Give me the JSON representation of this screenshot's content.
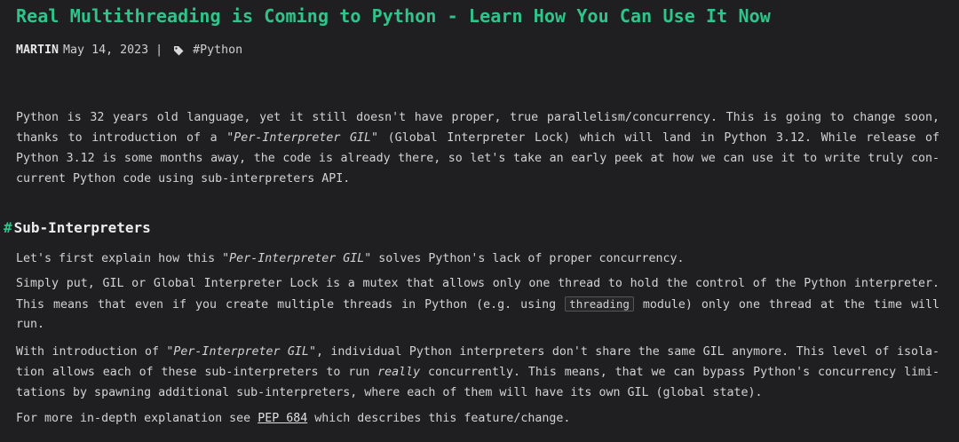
{
  "article": {
    "title": "Real Multithreading is Coming to Python - Learn How You Can Use It Now",
    "author": "MARTIN",
    "date": "May 14, 2023",
    "separator": "|",
    "tag": "#Python",
    "accent_color": "#2fc48a"
  },
  "heading": {
    "hash": "#",
    "text": "Sub-Interpreters"
  },
  "paragraphs": [
    [
      [
        {
          "t": "Python is 32 years old language, yet it still doesn't have proper, true parallelism/concurrency. This is going to change soon,"
        }
      ],
      [
        {
          "t": "thanks to introduction of a "
        },
        {
          "t": "\"Per-Interpreter GIL\"",
          "s": "it"
        },
        {
          "t": " (Global Interpreter Lock) which will land in Python 3.12. While release of"
        }
      ],
      [
        {
          "t": "Python 3.12 is some months away, the code is already there, so let's take an early peek at how we can use it to write truly con-"
        }
      ],
      [
        {
          "t": "current Python code using sub-interpreters API."
        }
      ]
    ],
    [
      [
        {
          "t": "Let's first explain how this "
        },
        {
          "t": "\"Per-Interpreter GIL\"",
          "s": "it"
        },
        {
          "t": " solves Python's lack of proper concurrency."
        }
      ]
    ],
    [
      [
        {
          "t": "Simply put, GIL or Global Interpreter Lock is a mutex that allows only one thread to hold the control of the Python interpreter."
        }
      ],
      [
        {
          "t": "This means that even if you create multiple threads in Python (e.g. using "
        },
        {
          "t": "threading",
          "s": "code"
        },
        {
          "t": " module) only one thread at the time will"
        }
      ],
      [
        {
          "t": "run."
        }
      ]
    ],
    [
      [
        {
          "t": "With introduction of "
        },
        {
          "t": "\"Per-Interpreter GIL\"",
          "s": "it"
        },
        {
          "t": ", individual Python interpreters don't share the same GIL anymore. This level of isola-"
        }
      ],
      [
        {
          "t": "tion allows each of these sub-interpreters to run "
        },
        {
          "t": "really",
          "s": "it"
        },
        {
          "t": " concurrently. This means, that we can bypass Python's concurrency limi-"
        }
      ],
      [
        {
          "t": "tations by spawning additional sub-interpreters, where each of them will have its own GIL (global state)."
        }
      ]
    ],
    [
      [
        {
          "t": "For more in-depth explanation see "
        },
        {
          "t": "PEP 684",
          "s": "link"
        },
        {
          "t": " which describes this feature/change."
        }
      ]
    ]
  ]
}
